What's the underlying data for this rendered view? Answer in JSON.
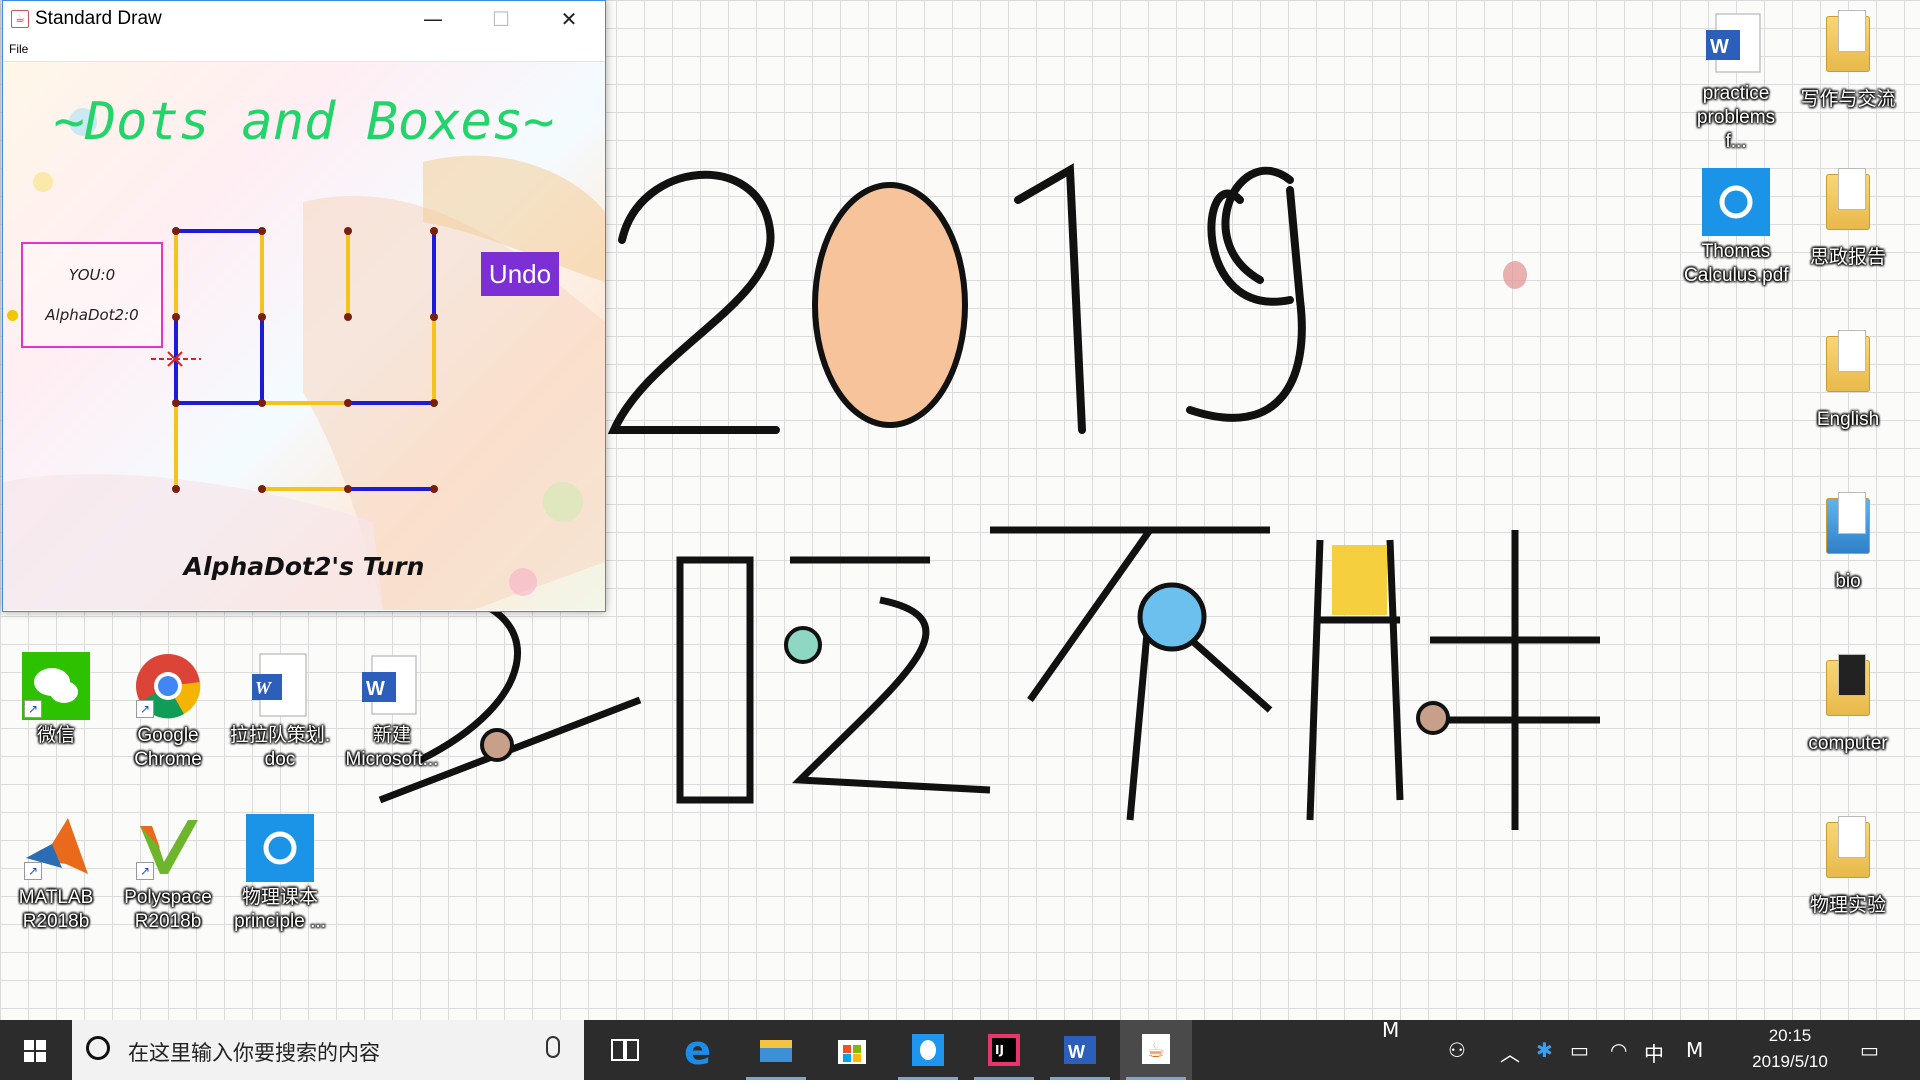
{
  "window": {
    "title": "Standard Draw",
    "menu": [
      "File"
    ],
    "buttons": {
      "minimize": "—",
      "maximize": "☐",
      "close": "✕"
    }
  },
  "game": {
    "title": "~Dots and Boxes~",
    "score_you": "YOU:0",
    "score_ai": "AlphaDot2:0",
    "undo_label": "Undo",
    "turn_text": "AlphaDot2's Turn",
    "colors": {
      "blue": "#1b1bd8",
      "yellow": "#f6c21c",
      "dot": "#7a1e10",
      "title": "#22d46a",
      "undo": "#7d2fd6"
    }
  },
  "wallpaper": {
    "year": "2019",
    "slogan": "多吃不胖"
  },
  "desktop_icons": [
    {
      "label": "practice\nproblems f...",
      "icon": "word-doc-icon"
    },
    {
      "label": "写作与交流",
      "icon": "folder-icon"
    },
    {
      "label": "Thomas\nCalculus.pdf",
      "icon": "pdf-reader-icon"
    },
    {
      "label": "思政报告",
      "icon": "folder-icon"
    },
    {
      "label": "English",
      "icon": "folder-icon"
    },
    {
      "label": "bio",
      "icon": "folder-icon"
    },
    {
      "label": "computer",
      "icon": "folder-icon"
    },
    {
      "label": "物理实验",
      "icon": "folder-icon"
    },
    {
      "label": "微信",
      "icon": "wechat-icon"
    },
    {
      "label": "Google\nChrome",
      "icon": "chrome-icon"
    },
    {
      "label": "拉拉队策划.\ndoc",
      "icon": "word-doc-icon"
    },
    {
      "label": "新建\nMicrosoft...",
      "icon": "word-doc-icon"
    },
    {
      "label": "MATLAB\nR2018b",
      "icon": "matlab-icon"
    },
    {
      "label": "Polyspace\nR2018b",
      "icon": "polyspace-icon"
    },
    {
      "label": "物理课本\nprinciple ...",
      "icon": "pdf-reader-icon"
    }
  ],
  "taskbar": {
    "search_placeholder": "在这里输入你要搜索的内容",
    "apps": [
      "task-view-icon",
      "edge-icon",
      "file-explorer-icon",
      "store-icon",
      "qq-icon",
      "intellij-icon",
      "word-icon",
      "java-icon"
    ],
    "tray": {
      "ime_mode": "中",
      "m_label": "M",
      "m_label_top": "M"
    },
    "clock_time": "20:15",
    "clock_date": "2019/5/10"
  }
}
